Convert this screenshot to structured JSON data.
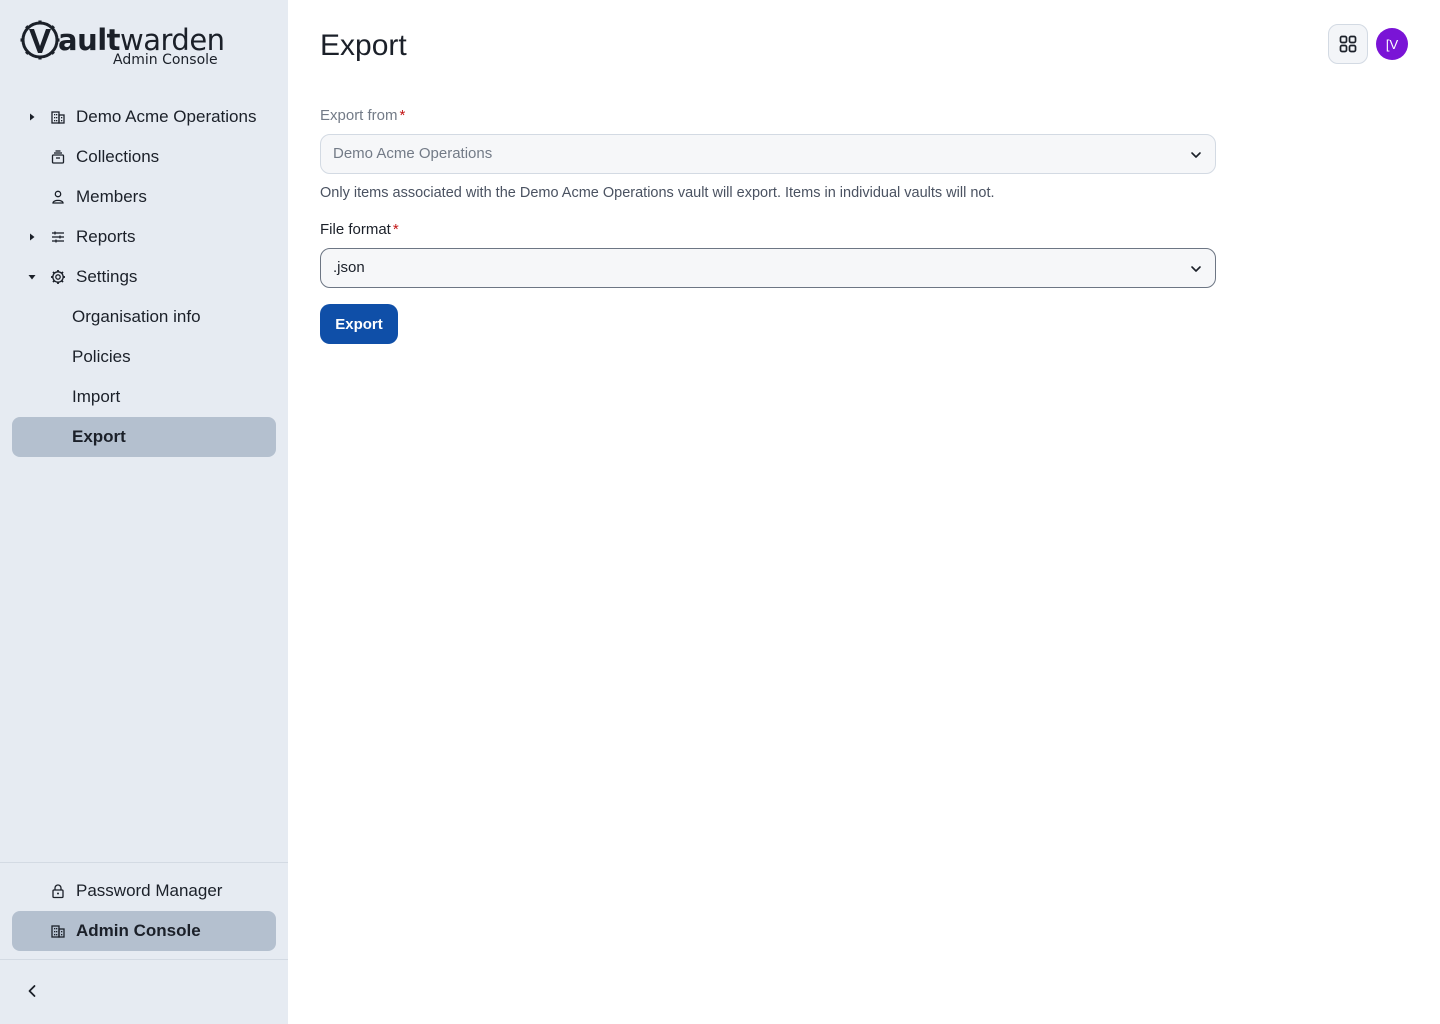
{
  "brand": {
    "name_bold": "ault",
    "name_light": "warden",
    "subtitle": "Admin Console"
  },
  "sidebar": {
    "items": [
      {
        "label": "Demo Acme Operations",
        "icon": "building-icon",
        "expandable": true,
        "expanded": false
      },
      {
        "label": "Collections",
        "icon": "collection-icon"
      },
      {
        "label": "Members",
        "icon": "user-icon"
      },
      {
        "label": "Reports",
        "icon": "sliders-icon",
        "expandable": true,
        "expanded": false
      },
      {
        "label": "Settings",
        "icon": "gear-icon",
        "expandable": true,
        "expanded": true
      },
      {
        "label": "Organisation info",
        "sub": true
      },
      {
        "label": "Policies",
        "sub": true
      },
      {
        "label": "Import",
        "sub": true
      },
      {
        "label": "Export",
        "sub": true,
        "active": true
      }
    ],
    "bottom": [
      {
        "label": "Password Manager",
        "icon": "lock-icon"
      },
      {
        "label": "Admin Console",
        "icon": "building-icon",
        "active": true
      }
    ]
  },
  "header": {
    "title": "Export",
    "avatar_initials": "[V"
  },
  "form": {
    "export_from": {
      "label": "Export from",
      "required": "*",
      "value": "Demo Acme Operations",
      "disabled": true
    },
    "hint": "Only items associated with the Demo Acme Operations vault will export. Items in individual vaults will not.",
    "file_format": {
      "label": "File format",
      "required": "*",
      "value": ".json"
    },
    "submit_label": "Export"
  },
  "colors": {
    "sidebar_bg": "#e6ebf2",
    "active_bg": "#b4c0cf",
    "primary": "#0f4fa8",
    "avatar": "#7a14d6",
    "required": "#c21414"
  }
}
